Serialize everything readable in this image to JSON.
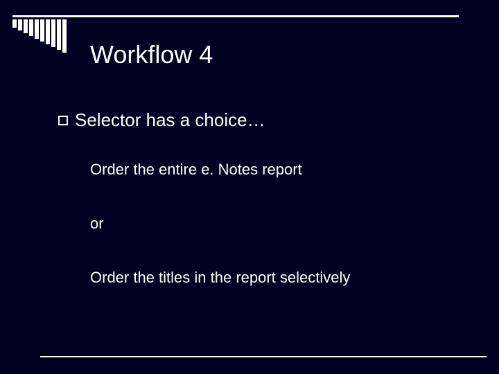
{
  "slide": {
    "title": "Workflow 4",
    "bullet": "Selector has a choice…",
    "line1": "Order the entire e. Notes report",
    "line2": "or",
    "line3": "Order the titles in the report selectively"
  }
}
